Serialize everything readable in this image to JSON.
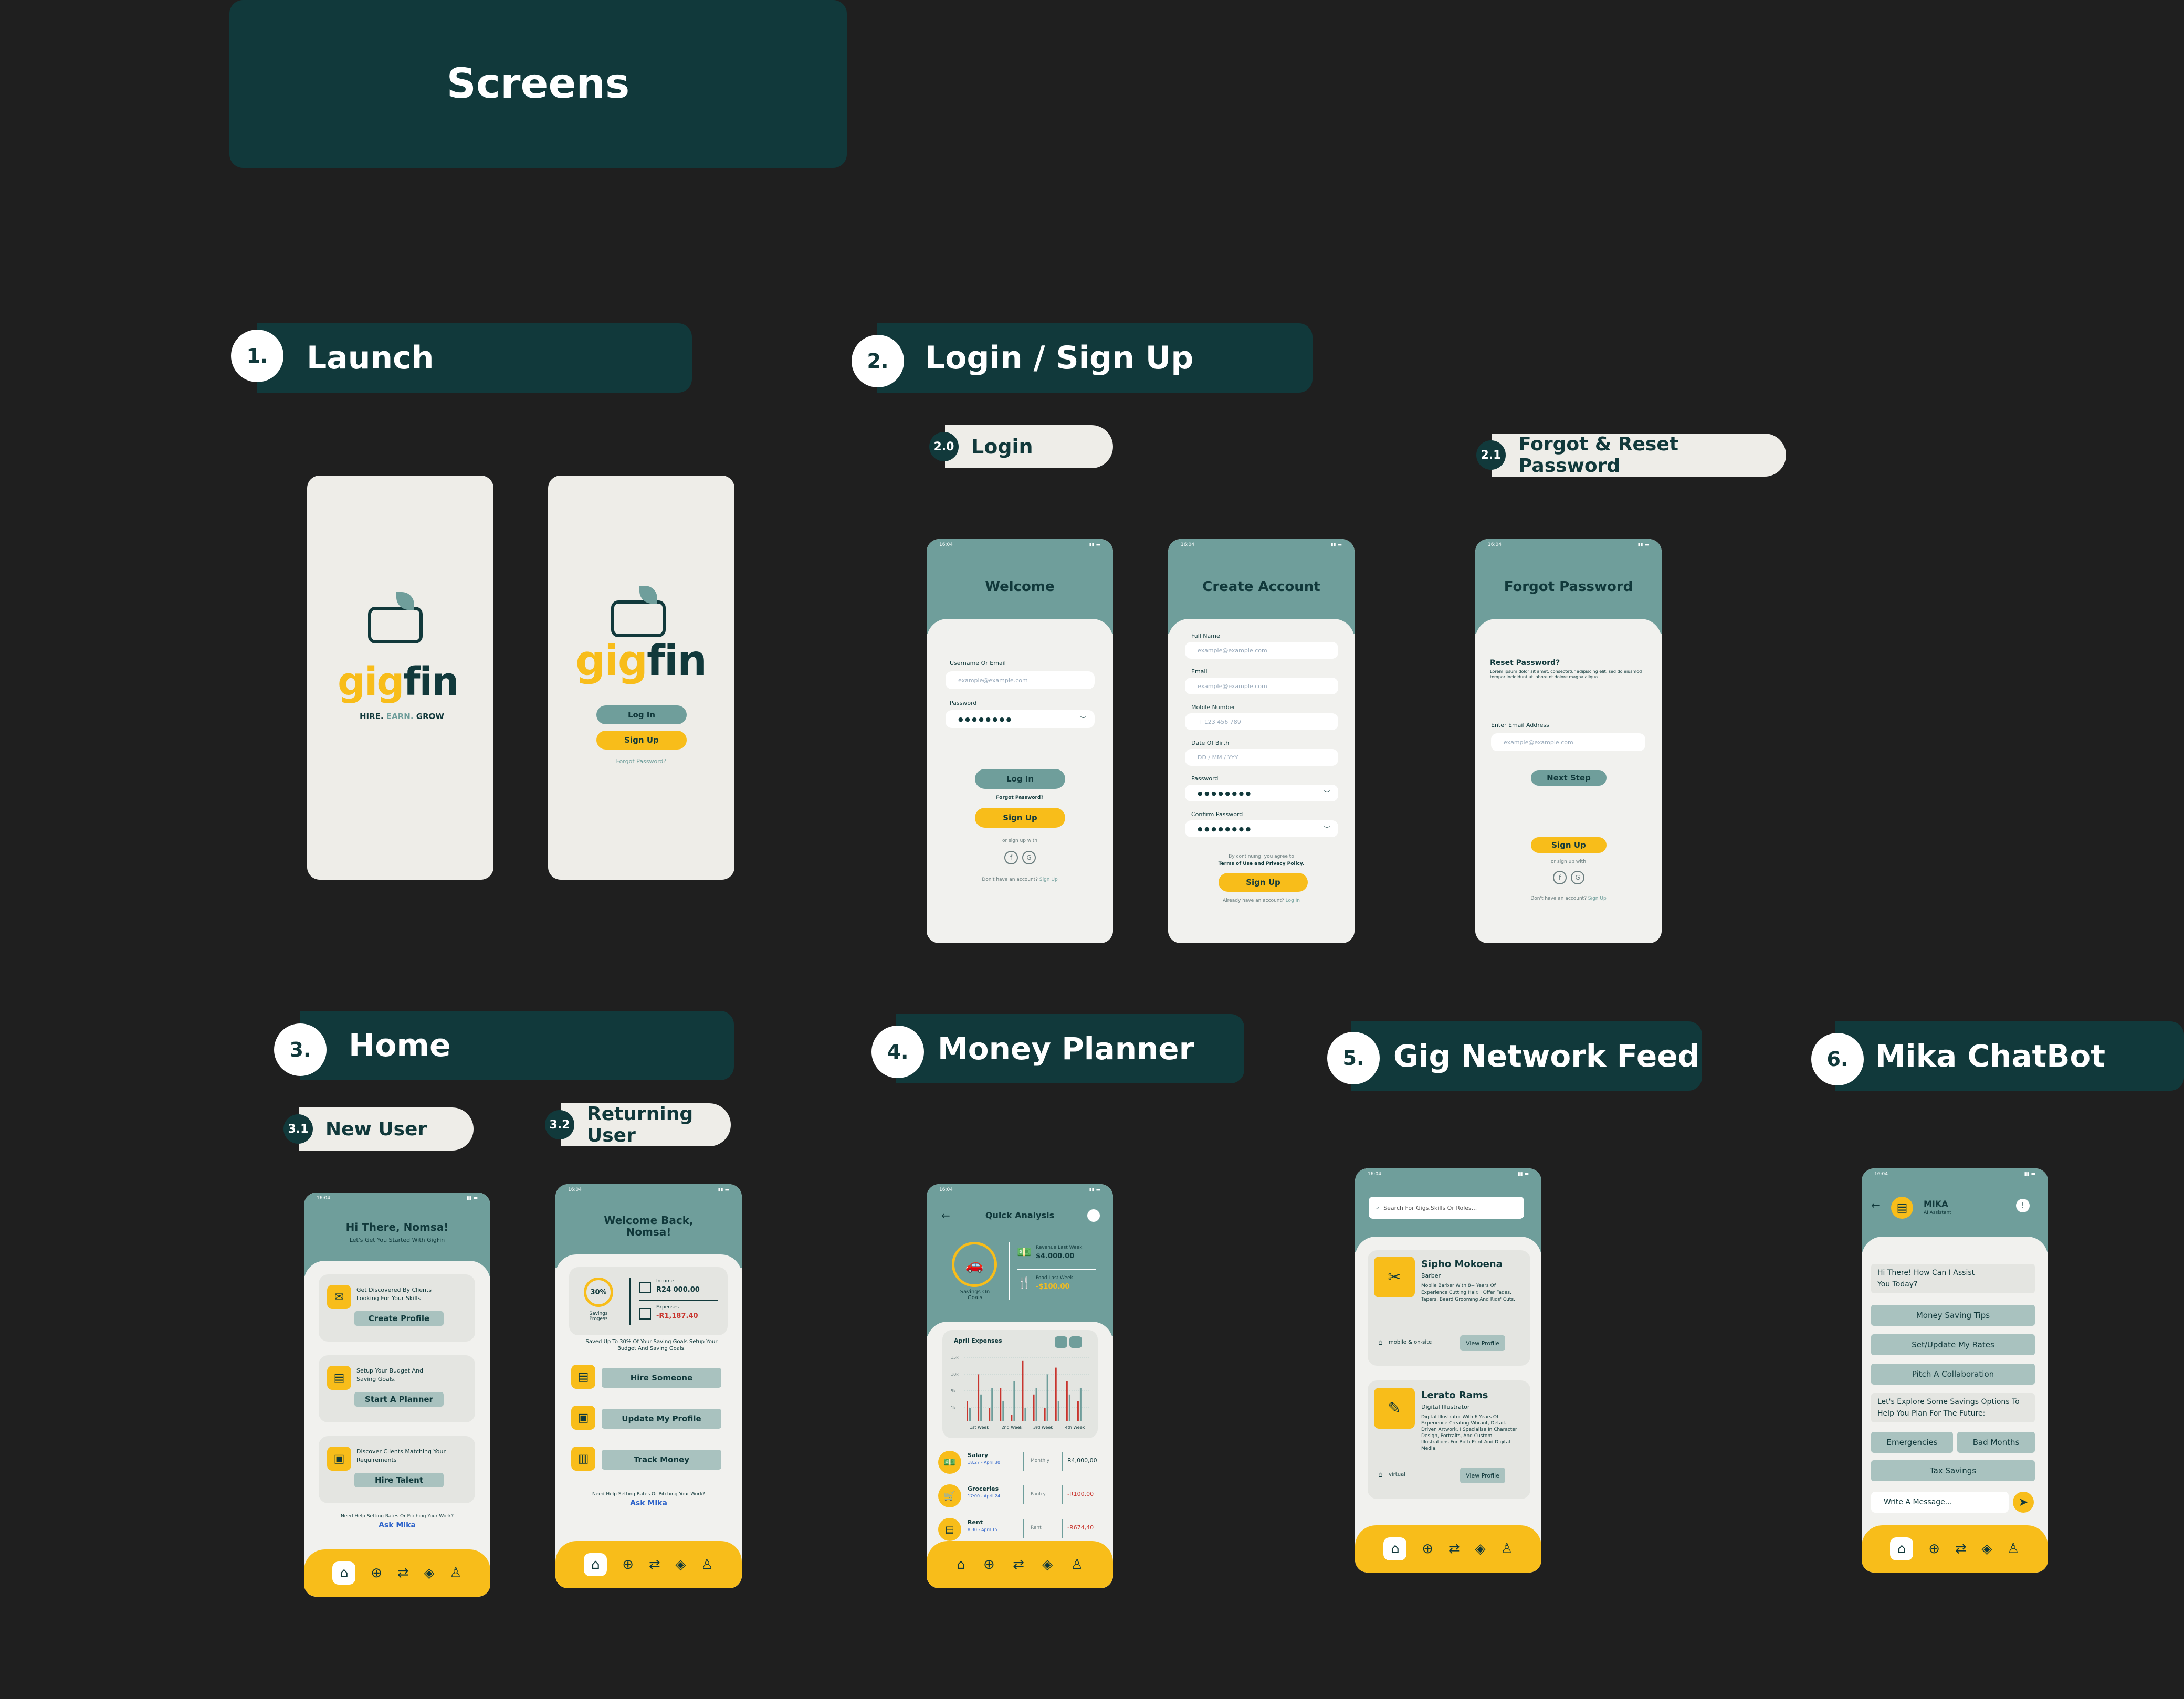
{
  "page": {
    "title": "Screens"
  },
  "sections": [
    {
      "number": "1.",
      "label": "Launch"
    },
    {
      "number": "2.",
      "label": "Login / Sign Up"
    },
    {
      "number": "3.",
      "label": "Home"
    },
    {
      "number": "4.",
      "label": "Money Planner"
    },
    {
      "number": "5.",
      "label": "Gig Network Feed"
    },
    {
      "number": "6.",
      "label": "Mika ChatBot"
    }
  ],
  "subsections": [
    {
      "number": "2.0",
      "label": "Login"
    },
    {
      "number": "2.1",
      "label": "Forgot & Reset Password"
    },
    {
      "number": "3.1",
      "label": "New User"
    },
    {
      "number": "3.2",
      "label": "Returning User"
    }
  ],
  "colors": {
    "background": "#1f1f1f",
    "dark_teal": "#11393b",
    "teal": "#6f9e9b",
    "yellow": "#f8bd1a",
    "offwhite": "#eeede8",
    "red": "#c8352e"
  },
  "status_time": "16:04",
  "launch": {
    "brand_gig": "gig",
    "brand_fin": "fin",
    "tagline_hire": "HIRE.",
    "tagline_earn": "EARN.",
    "tagline_grow": "GROW",
    "login": "Log In",
    "signup": "Sign Up",
    "forgot": "Forgot Password?"
  },
  "welcome": {
    "title": "Welcome",
    "username_label": "Username Or Email",
    "username_placeholder": "example@example.com",
    "password_label": "Password",
    "password_mask": "● ● ● ● ● ● ● ●",
    "login": "Log In",
    "forgot": "Forgot Password?",
    "signup": "Sign Up",
    "or": "or sign up with",
    "no_account": "Don't have an account?",
    "signup_link": "Sign Up"
  },
  "create": {
    "title": "Create Account",
    "fullname_label": "Full Name",
    "fullname_placeholder": "example@example.com",
    "email_label": "Email",
    "email_placeholder": "example@example.com",
    "mobile_label": "Mobile Number",
    "mobile_placeholder": "+ 123 456 789",
    "dob_label": "Date Of Birth",
    "dob_placeholder": "DD / MM / YYY",
    "password_label": "Password",
    "password_mask": "● ● ● ● ● ● ● ●",
    "confirm_label": "Confirm Password",
    "confirm_mask": "● ● ● ● ● ● ● ●",
    "terms_1": "By continuing, you agree to",
    "terms_2": "Terms of Use and Privacy Policy.",
    "signup": "Sign Up",
    "have_account": "Already have an account?",
    "login_link": "Log In"
  },
  "forgot": {
    "title": "Forgot Password",
    "heading": "Reset Password?",
    "body": "Lorem ipsum dolor sit amet, consectetur adipiscing elit, sed do eiusmod tempor incididunt ut labore et dolore magna aliqua.",
    "email_label": "Enter Email Address",
    "email_placeholder": "example@example.com",
    "next": "Next Step",
    "signup": "Sign Up",
    "or": "or sign up with",
    "no_account": "Don't have an account?",
    "signup_link": "Sign Up"
  },
  "home_new": {
    "greeting": "Hi There, Nomsa!",
    "subtitle": "Let's Get You Started With GigFin",
    "card1_text": "Get Discovered By Clients Looking For Your Skills",
    "card1_btn": "Create Profile",
    "card2_text": "Setup Your Budget And Saving Goals.",
    "card2_btn": "Start A Planner",
    "card3_text": "Discover Clients Matching Your Requirements",
    "card3_btn": "Hire Talent",
    "help": "Need Help Setting Rates Or Pitching Your Work?",
    "ask": "Ask Mika"
  },
  "home_return": {
    "greeting": "Welcome Back, Nomsa!",
    "progress": "30%",
    "progress_label": "Savings Progess",
    "income_label": "Income",
    "income": "R24 000.00",
    "expenses_label": "Expenses",
    "expenses": "-R1,187.40",
    "saved": "Saved Up To 30% Of Your Saving Goals Setup Your Budget And Saving Goals.",
    "btn1": "Hire Someone",
    "btn2": "Update My Profile",
    "btn3": "Track Money",
    "help": "Need Help Setting Rates Or Pitching Your Work?",
    "ask": "Ask Mika"
  },
  "money": {
    "title": "Quick Analysis",
    "goal_label": "Savings On Goals",
    "revenue_label": "Revenue Last Week",
    "revenue": "$4.000.00",
    "food_label": "Food Last Week",
    "food": "-$100.00",
    "chart_title": "April Expenses",
    "rows": [
      {
        "name": "Salary",
        "date": "18:27 - April 30",
        "freq": "Monthly",
        "amount": "R4,000,00"
      },
      {
        "name": "Groceries",
        "date": "17:00 - April 24",
        "freq": "Pantry",
        "amount": "-R100,00"
      },
      {
        "name": "Rent",
        "date": "8:30 - April 15",
        "freq": "Rent",
        "amount": "-R674,40"
      }
    ]
  },
  "chart_data": {
    "type": "bar",
    "categories": [
      "1st Week",
      "2nd Week",
      "3rd Week",
      "4th Week"
    ],
    "yticks": [
      "15k",
      "10k",
      "5k",
      "1k"
    ],
    "series": [
      {
        "values": [
          3,
          7,
          2,
          5,
          1,
          9,
          4,
          2,
          8,
          6,
          3
        ]
      },
      {
        "values": [
          2,
          4,
          5,
          3,
          6,
          2,
          5,
          7,
          3,
          4,
          5
        ]
      }
    ]
  },
  "gig": {
    "search_placeholder": "Search For Gigs,Skills Or Roles...",
    "p1_name": "Sipho Mokoena",
    "p1_role": "Barber",
    "p1_bio": "Mobile Barber With 8+ Years Of Experience Cutting Hair. I Offer Fades, Tapers, Beard Grooming And Kids' Cuts.",
    "p1_loc": "mobile & on-site",
    "p1_btn": "View Profile",
    "p2_name": "Lerato Rams",
    "p2_role": "Digital Illustrator",
    "p2_bio": "Digital Illustrator With 6 Years Of Experience Creating Vibrant, Detail-Driven Artwork. I Specialise In Character Design, Portraits, And Custom Illustrations For Both Print And Digital Media.",
    "p2_loc": "virtual",
    "p2_btn": "View Profile"
  },
  "mika": {
    "name": "MIKA",
    "role": "AI Assistant",
    "greeting": "Hi There! How Can I Assist You Today?",
    "opt1": "Money Saving Tips",
    "opt2": "Set/Update My Rates",
    "opt3": "Pitch A Collaboration",
    "explore": "Let's Explore Some Savings Options To Help You Plan For The Future:",
    "opt4": "Emergencies",
    "opt5": "Bad Months",
    "opt6": "Tax Savings",
    "input_placeholder": "Write A Message..."
  }
}
